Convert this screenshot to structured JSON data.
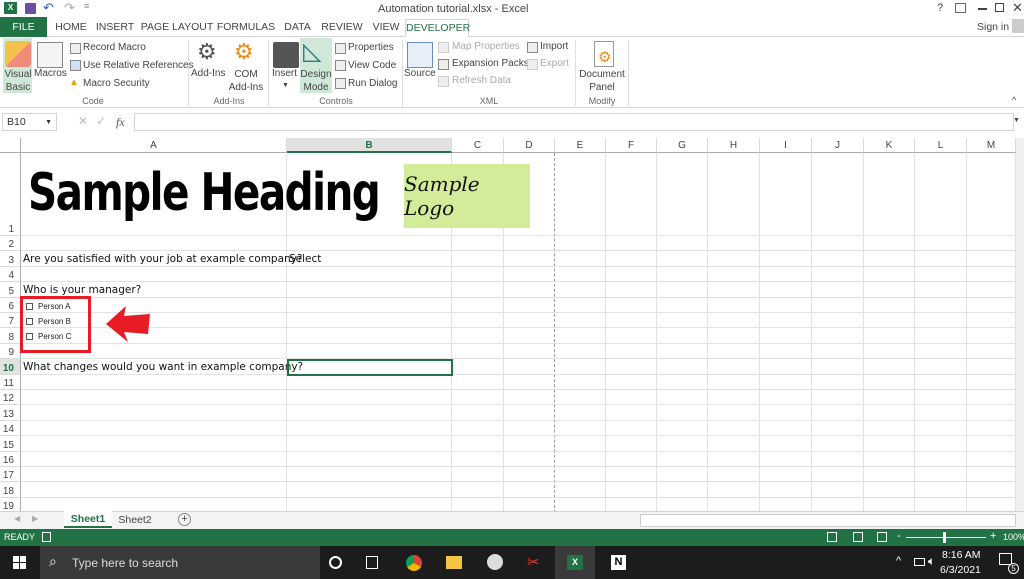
{
  "app": {
    "title": "Automation tutorial.xlsx - Excel",
    "sign_in": "Sign in",
    "help": "?"
  },
  "tabs": [
    "FILE",
    "HOME",
    "INSERT",
    "PAGE LAYOUT",
    "FORMULAS",
    "DATA",
    "REVIEW",
    "VIEW",
    "DEVELOPER"
  ],
  "active_tab": "DEVELOPER",
  "ribbon": {
    "code": {
      "label": "Code",
      "visual_basic": "Visual Basic",
      "macros": "Macros",
      "record_macro": "Record Macro",
      "use_relative": "Use Relative References",
      "macro_security": "Macro Security"
    },
    "addins": {
      "label": "Add-Ins",
      "addins": "Add-Ins",
      "com_addins": "COM Add-Ins"
    },
    "controls": {
      "label": "Controls",
      "insert": "Insert",
      "design_mode": "Design Mode",
      "properties": "Properties",
      "view_code": "View Code",
      "run_dialog": "Run Dialog"
    },
    "xml": {
      "label": "XML",
      "source": "Source",
      "map_properties": "Map Properties",
      "expansion_packs": "Expansion Packs",
      "refresh_data": "Refresh Data",
      "import": "Import",
      "export": "Export"
    },
    "modify": {
      "label": "Modify",
      "document_panel": "Document Panel"
    }
  },
  "formula_bar": {
    "name_box": "B10",
    "fx": "fx",
    "value": ""
  },
  "columns": [
    "A",
    "B",
    "C",
    "D",
    "E",
    "F",
    "G",
    "H",
    "I",
    "J",
    "K",
    "L",
    "M"
  ],
  "selected_column": "B",
  "selected_row": "10",
  "rows": [
    "1",
    "2",
    "3",
    "4",
    "5",
    "6",
    "7",
    "8",
    "9",
    "10",
    "11",
    "12",
    "13",
    "14",
    "15",
    "16",
    "17",
    "18",
    "19"
  ],
  "cells": {
    "heading": "Sample Heading",
    "logo": "Sample Logo",
    "a3": "Are you satisfied with your job at example company?",
    "b3": "Select",
    "a5": "Who is your manager?",
    "a10": "What changes would you want in example company?"
  },
  "checkboxes": [
    {
      "label": "Person A",
      "checked": false
    },
    {
      "label": "Person B",
      "checked": false
    },
    {
      "label": "Person C",
      "checked": false
    }
  ],
  "sheets": [
    "Sheet1",
    "Sheet2"
  ],
  "active_sheet": "Sheet1",
  "status": {
    "ready": "READY",
    "zoom": "100%"
  },
  "taskbar": {
    "search_placeholder": "Type here to search",
    "time": "8:16 AM",
    "date": "6/3/2021",
    "notifications": "5"
  },
  "colors": {
    "excel_green": "#217346",
    "highlight": "#e81c24",
    "logo_bg": "#d3ec99"
  }
}
